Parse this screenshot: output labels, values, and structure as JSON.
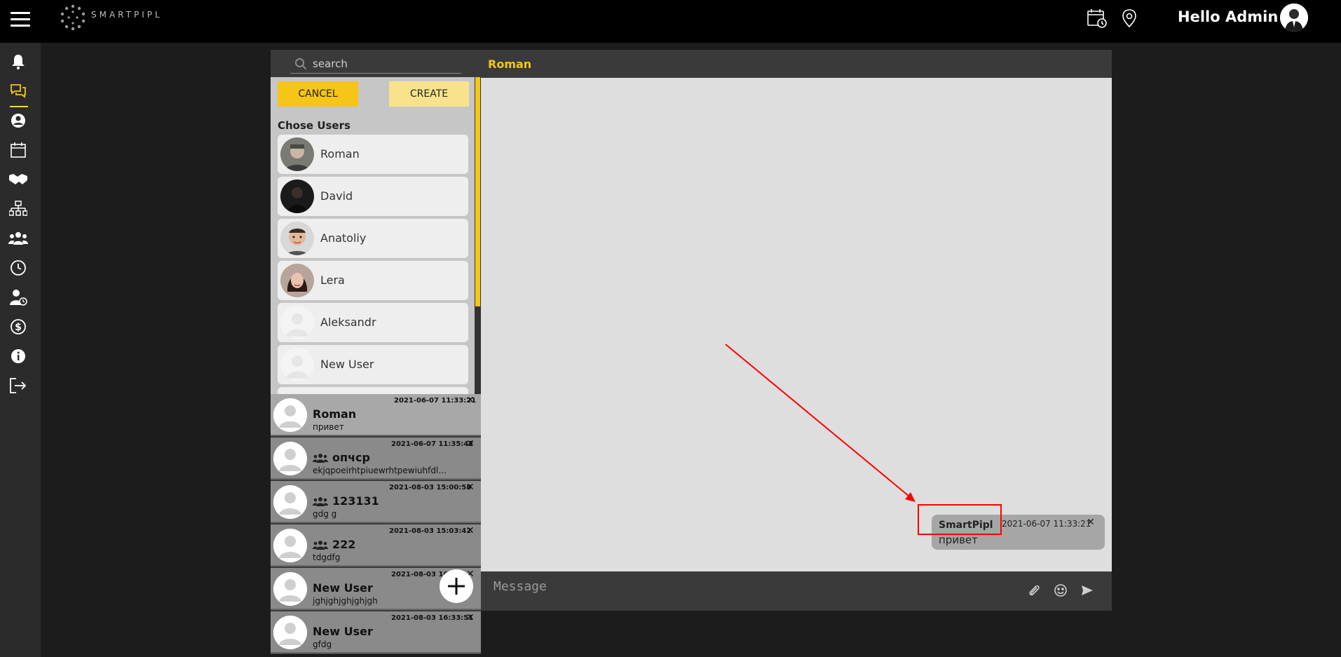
{
  "app": {
    "logo_text": "SMARTPIPL",
    "greeting": "Hello Admin"
  },
  "search": {
    "placeholder": "search"
  },
  "picker": {
    "cancel_label": "CANCEL",
    "create_label": "CREATE",
    "title": "Chose Users",
    "users": [
      {
        "name": "Roman"
      },
      {
        "name": "David"
      },
      {
        "name": "Anatoliy"
      },
      {
        "name": "Lera"
      },
      {
        "name": "Aleksandr"
      },
      {
        "name": "New User"
      }
    ]
  },
  "chats": [
    {
      "title": "Roman",
      "subtitle": "привет",
      "timestamp": "2021-06-07 11:33:21",
      "group": false
    },
    {
      "title": "опчср",
      "subtitle": "ekjqpoeirhtpiuewrhtpewiuhfdl...",
      "timestamp": "2021-06-07 11:35:42",
      "group": true
    },
    {
      "title": "123131",
      "subtitle": "gdg g",
      "timestamp": "2021-08-03 15:00:58",
      "group": true
    },
    {
      "title": "222",
      "subtitle": "tdgdfg",
      "timestamp": "2021-08-03 15:03:42",
      "group": true
    },
    {
      "title": "New User",
      "subtitle": "jghjghjghjghjgh",
      "timestamp": "2021-08-03 16:",
      "group": false
    },
    {
      "title": "New User",
      "subtitle": "gfdg",
      "timestamp": "2021-08-03 16:33:51",
      "group": false
    }
  ],
  "chat": {
    "header_name": "Roman",
    "message": {
      "sender": "SmartPipl",
      "timestamp": "2021-06-07 11:33:21",
      "text": "привет"
    },
    "compose_placeholder": "Message"
  },
  "close_glyph": "✕",
  "colors": {
    "accent": "#f5c518",
    "annotation": "#ff0000"
  }
}
